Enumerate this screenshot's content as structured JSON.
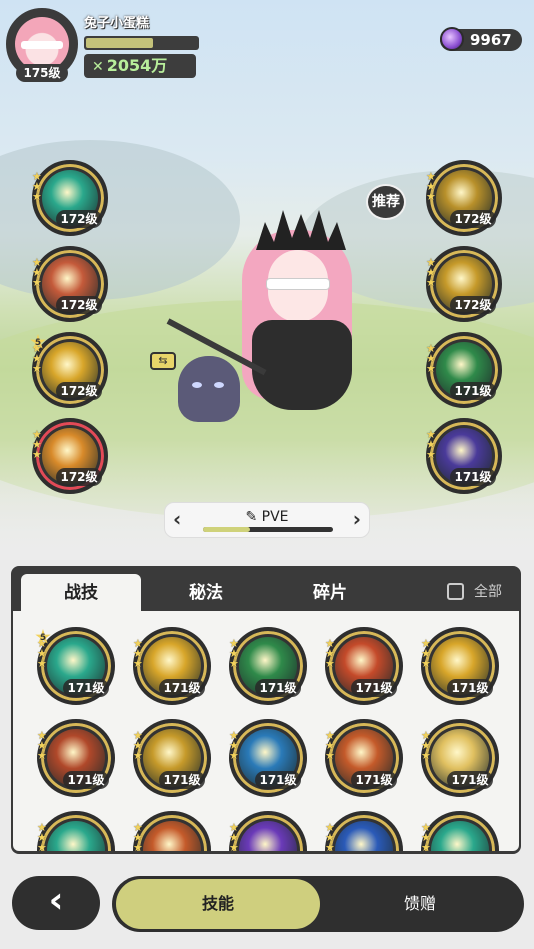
{
  "player": {
    "name": "兔子小蛋糕",
    "level": "175级",
    "exp_fraction": 0.6,
    "power": "2054万"
  },
  "currency": {
    "value": "9967",
    "icon": "purple-gem-icon"
  },
  "hero_view": {
    "recommend_label": "推荐",
    "left_skills": [
      {
        "level": "172级",
        "icon": "cyan-vortex-skill-icon",
        "color": "#2aa88c"
      },
      {
        "level": "172级",
        "icon": "red-slash-skill-icon",
        "color": "#c45a3a"
      },
      {
        "level": "172级",
        "icon": "golden-lightning-skill-icon",
        "color": "#d8a62a",
        "stars": "5"
      },
      {
        "level": "172级",
        "icon": "golden-burst-skill-icon",
        "color": "#d88a2a"
      }
    ],
    "right_skills": [
      {
        "level": "172级",
        "icon": "shield-skill-icon",
        "color": "#b8902a"
      },
      {
        "level": "172级",
        "icon": "golden-keyhole-skill-icon",
        "color": "#c69a2a"
      },
      {
        "level": "171级",
        "icon": "green-leaf-skill-icon",
        "color": "#2f8a4a"
      },
      {
        "level": "171级",
        "icon": "purple-orb-skill-icon",
        "color": "#4a3a9a"
      }
    ]
  },
  "mode_selector": {
    "label": "PVE",
    "progress_fraction": 0.36
  },
  "panel": {
    "tabs": [
      "战技",
      "秘法",
      "碎片"
    ],
    "filter_label": "全部",
    "skills": [
      {
        "level": "171级",
        "color": "#2aa88c",
        "stars": "5"
      },
      {
        "level": "171级",
        "color": "#d8a62a"
      },
      {
        "level": "171级",
        "color": "#2f8a4a"
      },
      {
        "level": "171级",
        "color": "#c44a2a"
      },
      {
        "level": "171级",
        "color": "#d8a62a"
      },
      {
        "level": "171级",
        "color": "#b0482a"
      },
      {
        "level": "171级",
        "color": "#c69a2a"
      },
      {
        "level": "171级",
        "color": "#2a7ab8"
      },
      {
        "level": "171级",
        "color": "#c45a2a"
      },
      {
        "level": "171级",
        "color": "#e0c060"
      },
      {
        "level": "",
        "color": "#2aa88c"
      },
      {
        "level": "",
        "color": "#c45a2a"
      },
      {
        "level": "",
        "color": "#6a3ab8"
      },
      {
        "level": "",
        "color": "#2a5ab8"
      },
      {
        "level": "",
        "color": "#2aa88c"
      }
    ]
  },
  "bottom_nav": {
    "skill_label": "技能",
    "gift_label": "馈赠"
  }
}
